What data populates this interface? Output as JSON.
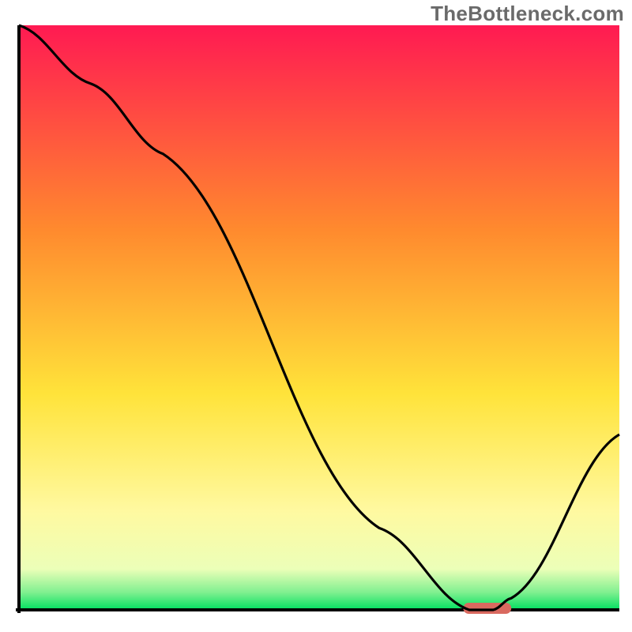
{
  "watermark": "TheBottleneck.com",
  "chart_data": {
    "type": "line",
    "title": "",
    "xlabel": "",
    "ylabel": "",
    "xlim": [
      0,
      100
    ],
    "ylim": [
      0,
      100
    ],
    "x": [
      0,
      12,
      24,
      60,
      75,
      79,
      82,
      100
    ],
    "values": [
      100,
      90,
      78,
      14,
      0,
      0,
      2,
      30
    ],
    "marker": {
      "x_start": 74,
      "x_end": 82,
      "y": 0
    }
  },
  "colors": {
    "gradient_top": "#ff1a52",
    "gradient_mid_orange": "#ff9a2e",
    "gradient_yellow": "#ffe33a",
    "gradient_pale_yellow": "#ffffb0",
    "gradient_green": "#00e060",
    "axis": "#000000",
    "line": "#000000",
    "marker": "#d9695f"
  }
}
